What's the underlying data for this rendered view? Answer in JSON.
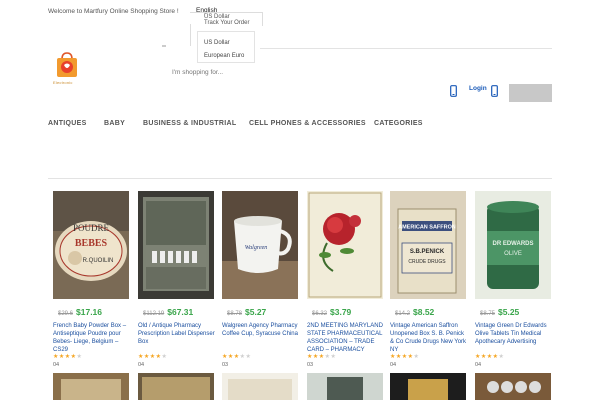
{
  "topbar": {
    "welcome": "Welcome to Martfury Online Shopping Store !",
    "language": "English",
    "currency_current": "US Dollar",
    "track_order": "Track Your Order",
    "dropdown_hint_1": "E",
    "dropdown_hint_2": "E"
  },
  "currency_menu": {
    "options": [
      "US Dollar",
      "European Euro"
    ]
  },
  "logo": {
    "text": "Electronic"
  },
  "search": {
    "placeholder": "I'm shopping for..."
  },
  "header": {
    "login": "Login"
  },
  "nav": {
    "items": [
      "ANTIQUES",
      "BABY",
      "BUSINESS & INDUSTRIAL",
      "CELL PHONES & ACCESSORIES",
      "CATEGORIES"
    ]
  },
  "products": [
    {
      "old_price": "$29.6",
      "price": "$17.16",
      "title": "French Baby Powder Box – Antiseptique Poudre pour Bebes- Liege, Belgium – CS29",
      "rating": 4,
      "count": "04"
    },
    {
      "old_price": "$112.19",
      "price": "$67.31",
      "title": "Old / Antique Pharmacy Prescription Label Dispenser Box",
      "rating": 4,
      "count": "04"
    },
    {
      "old_price": "$8.78",
      "price": "$5.27",
      "title": "Walgreen Agency Pharmacy Coffee Cup, Syracuse China",
      "rating": 3,
      "count": "03"
    },
    {
      "old_price": "$6.32",
      "price": "$3.79",
      "title": "2ND MEETING MARYLAND STATE PHARMACEUTICAL ASSOCIATION – TRADE CARD – PHARMACY",
      "rating": 3,
      "count": "03"
    },
    {
      "old_price": "$14.2",
      "price": "$8.52",
      "title": "Vintage American Saffron Unopened Box S. B. Penick & Co Crude Drugs New York NY",
      "rating": 4,
      "count": "04"
    },
    {
      "old_price": "$8.75",
      "price": "$5.25",
      "title": "Vintage Green Dr Edwards Olive Tablets Tin Medical Apothecary Advertising",
      "rating": 4,
      "count": "04"
    }
  ],
  "colors": {
    "price": "#3aa54b",
    "link": "#1a4e9e",
    "star": "#f5a623",
    "cart_button": "#c8c8c8"
  }
}
